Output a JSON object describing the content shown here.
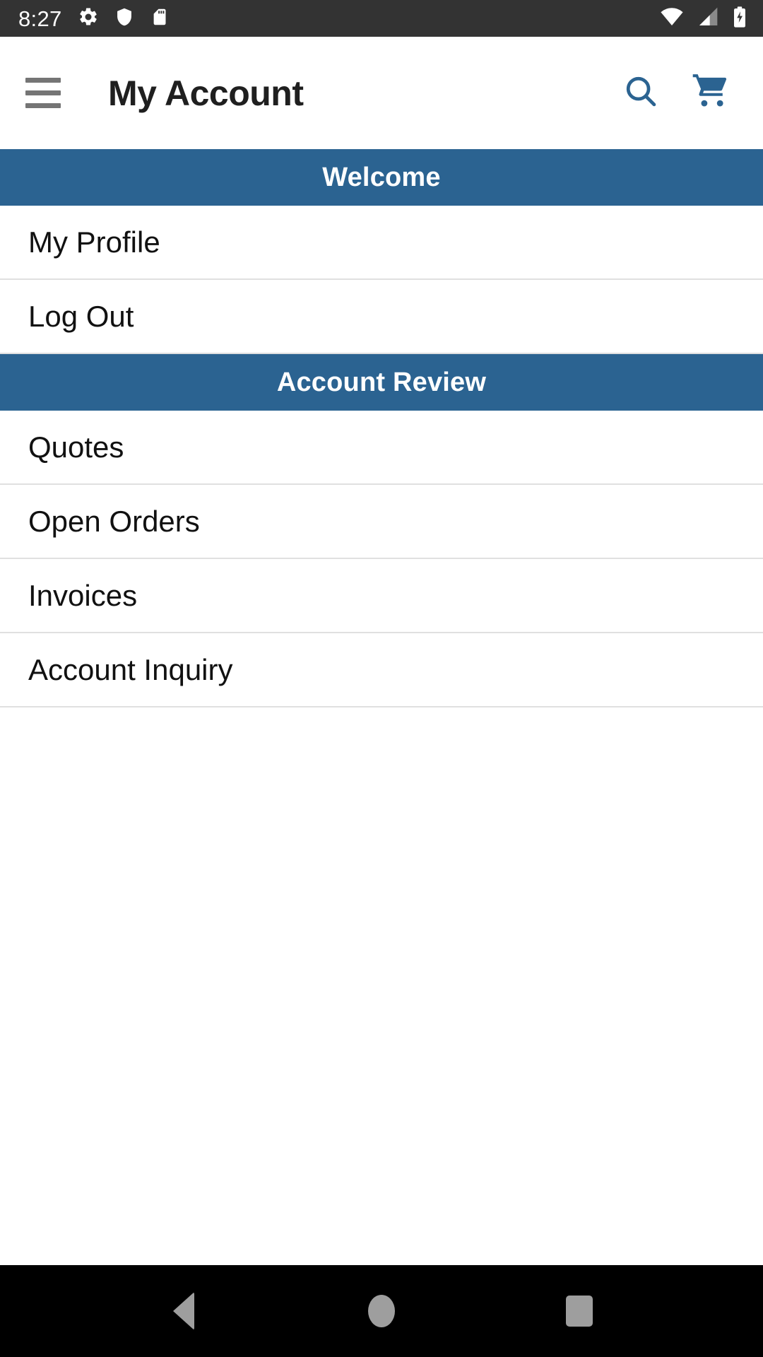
{
  "status_bar": {
    "time": "8:27",
    "left_icons": [
      "gear-icon",
      "shield-icon",
      "sd-card-icon"
    ],
    "right_icons": [
      "wifi-icon",
      "cellular-signal-icon",
      "battery-charging-icon"
    ],
    "background": "#333333",
    "foreground": "#ffffff"
  },
  "app_bar": {
    "menu_icon": "hamburger-menu-icon",
    "title": "My Account",
    "actions": [
      {
        "name": "search-icon",
        "label": "Search"
      },
      {
        "name": "shopping-cart-icon",
        "label": "Cart"
      }
    ],
    "accent_color": "#2b6391",
    "background": "#ffffff"
  },
  "sections": [
    {
      "header": "Welcome",
      "items": [
        {
          "label": "My Profile"
        },
        {
          "label": "Log Out"
        }
      ]
    },
    {
      "header": "Account Review",
      "items": [
        {
          "label": "Quotes"
        },
        {
          "label": "Open Orders"
        },
        {
          "label": "Invoices"
        },
        {
          "label": "Account Inquiry"
        }
      ]
    }
  ],
  "nav_bar": {
    "background": "#000000",
    "buttons": [
      {
        "name": "back-nav-icon",
        "label": "Back"
      },
      {
        "name": "home-nav-icon",
        "label": "Home"
      },
      {
        "name": "recents-nav-icon",
        "label": "Recents"
      }
    ]
  },
  "theme": {
    "header_blue": "#2b6391",
    "divider": "#e0e0e0",
    "text_primary": "#111111"
  }
}
